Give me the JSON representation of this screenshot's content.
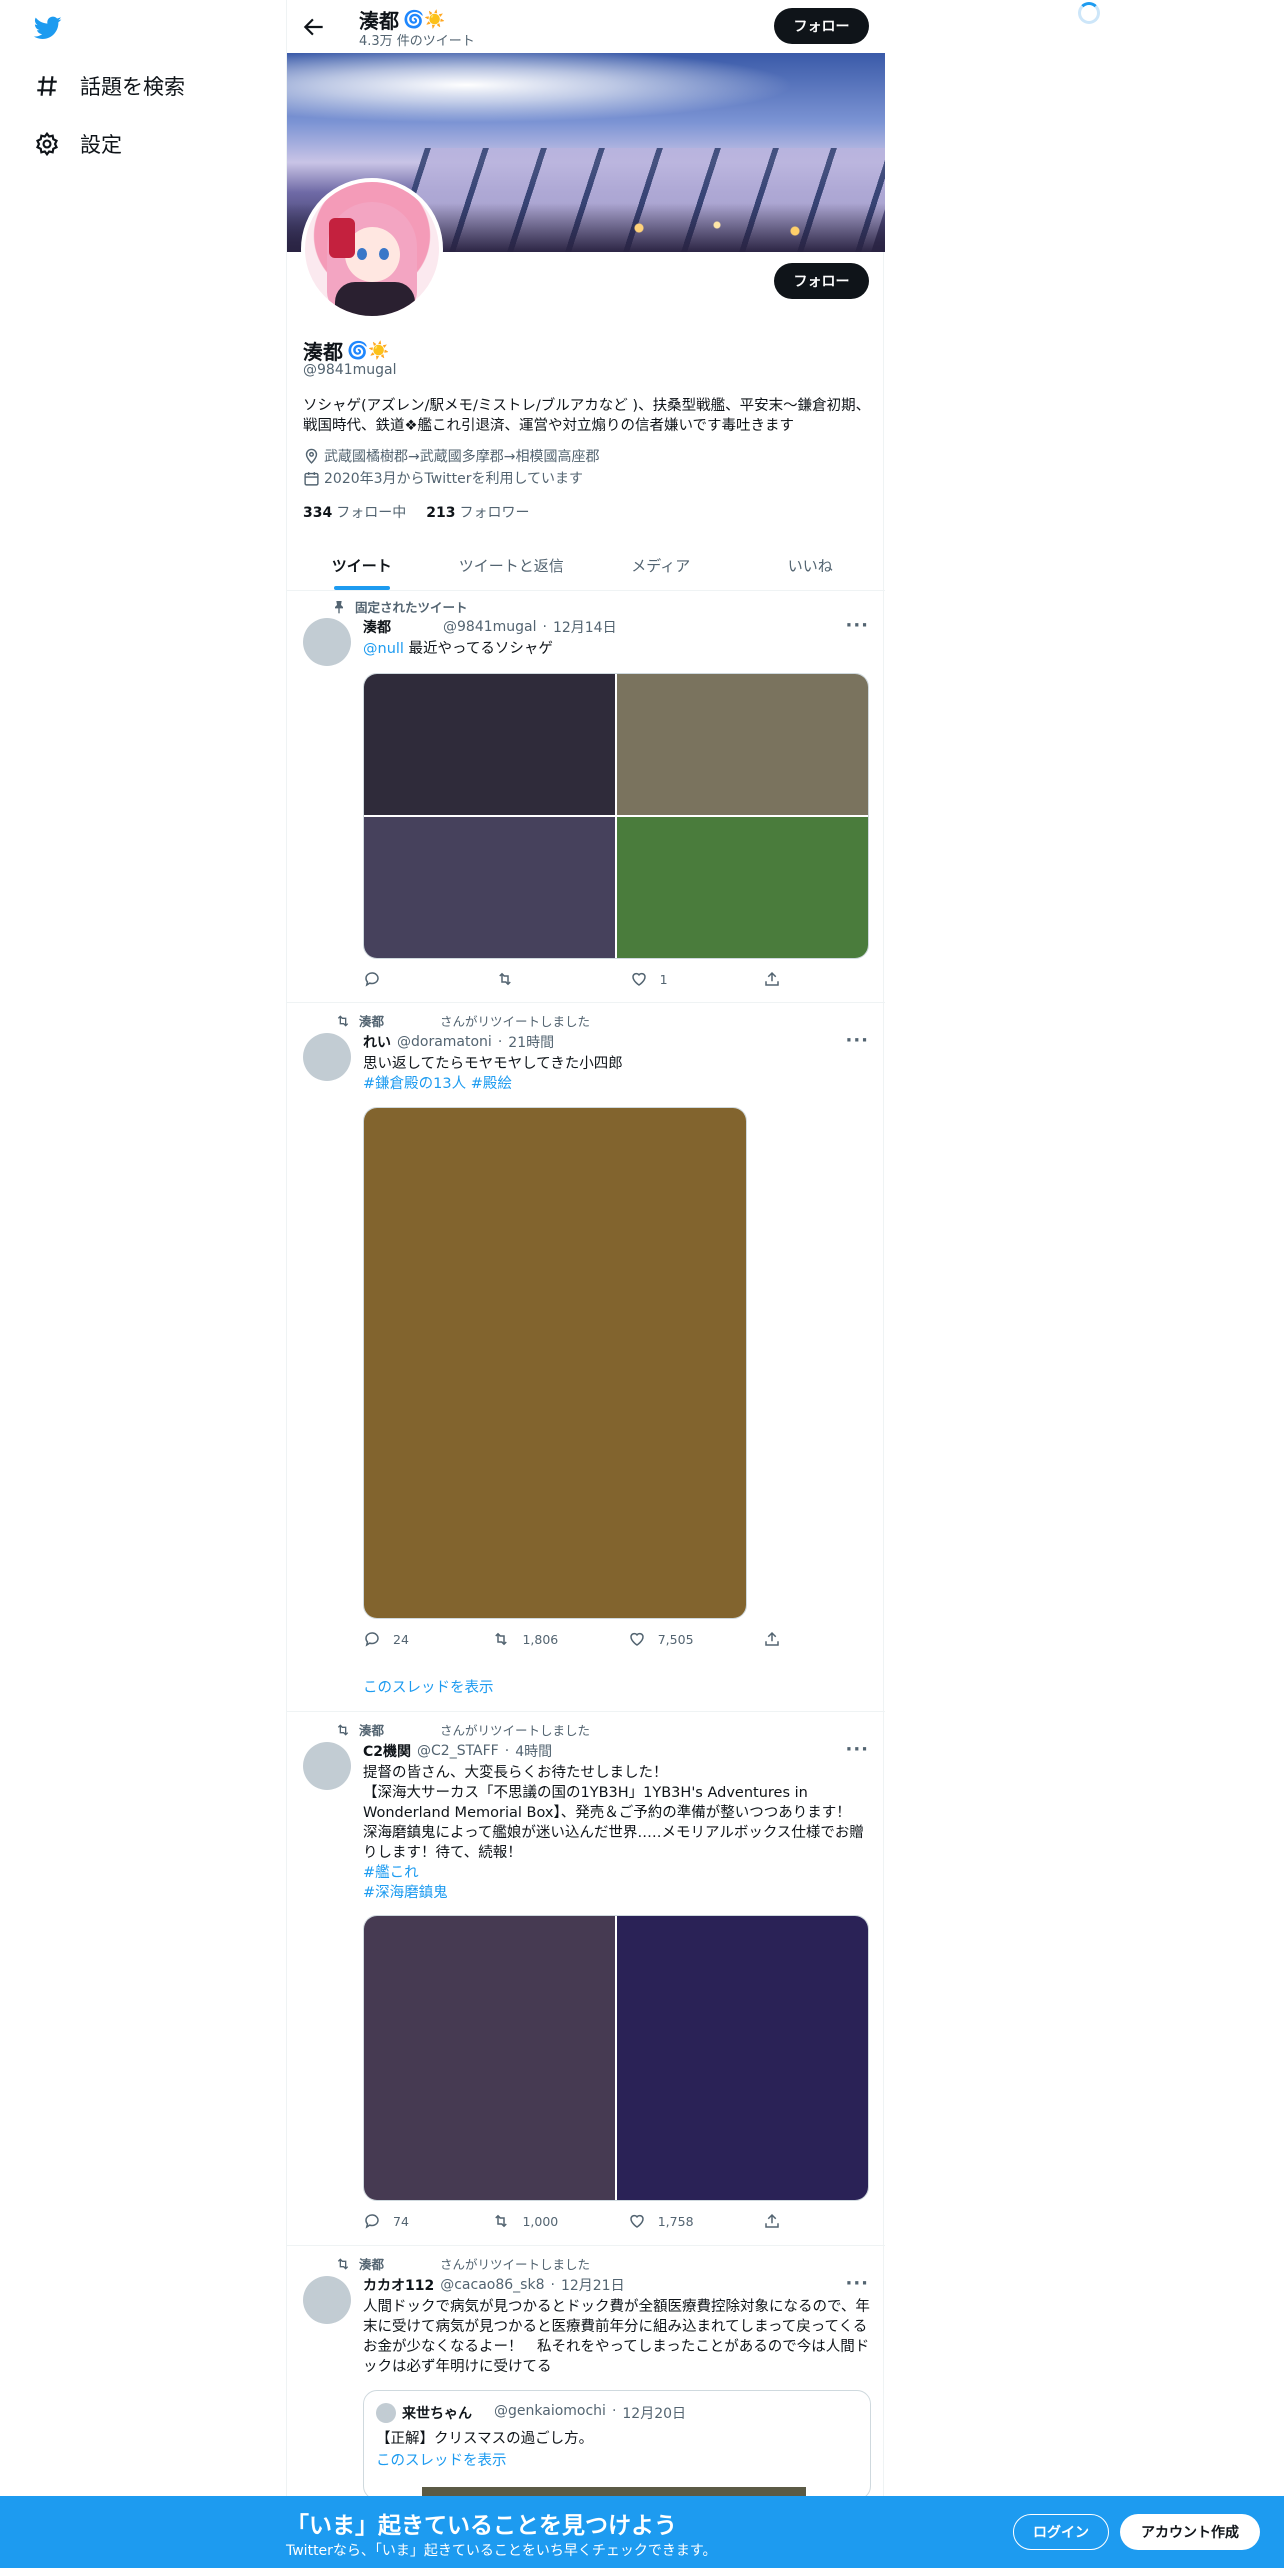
{
  "app": {
    "name": "Twitter"
  },
  "colors": {
    "accent": "#1d9bf0",
    "text": "#0f1419",
    "muted": "#536471"
  },
  "sidebar": {
    "items": [
      {
        "label": "話題を検索",
        "icon": "hashtag-icon"
      },
      {
        "label": "設定",
        "icon": "gear-icon"
      }
    ]
  },
  "header": {
    "name": "湊都",
    "tweet_count": "4.3万 件のツイート",
    "follow_label": "フォロー",
    "emoji": "🌀☀️"
  },
  "profile": {
    "name": "湊都",
    "handle": "@9841mugal",
    "bio": "ソシャゲ(アズレン/駅メモ/ミストレ/ブルアカなど )、扶桑型戦艦、平安末～鎌倉初期、戦国時代、鉄道❖艦これ引退済、運営や対立煽りの信者嫌いです毒吐きます",
    "location": "武蔵國橘樹郡→武蔵國多摩郡→相模國高座郡",
    "joined": "2020年3月からTwitterを利用しています",
    "following_count": "334",
    "following_label": "フォロー中",
    "followers_count": "213",
    "followers_label": "フォロワー",
    "follow_label": "フォロー"
  },
  "tabs": [
    {
      "label": "ツイート",
      "active": true
    },
    {
      "label": "ツイートと返信",
      "active": false
    },
    {
      "label": "メディア",
      "active": false
    },
    {
      "label": "いいね",
      "active": false
    }
  ],
  "tweets": [
    {
      "context": "固定されたツイート",
      "name": "湊都",
      "handle": "@9841mugal",
      "time": "12月14日",
      "mention": "@null",
      "text": "最近やってるソシャゲ",
      "media_colors": [
        "#2f2b3a",
        "#7a735e",
        "#46415c",
        "#4a7c3c"
      ],
      "replies": "",
      "retweets": "",
      "likes": "1"
    },
    {
      "context_name": "湊都",
      "context_suffix": "さんがリツイートしました",
      "name": "れい",
      "handle": "@doramatoni",
      "time": "21時間",
      "text": "思い返してたらモヤモヤしてきた小四郎",
      "hashtags": "#鎌倉殿の13人 #殿絵",
      "media_colors": [
        "#82642e"
      ],
      "replies": "24",
      "retweets": "1,806",
      "likes": "7,505",
      "thread": "このスレッドを表示"
    },
    {
      "context_name": "湊都",
      "context_suffix": "さんがリツイートしました",
      "name": "C2機関",
      "handle": "@C2_STAFF",
      "time": "4時間",
      "text_lines": [
        "提督の皆さん、大変長らくお待たせしました！",
        "【深海大サーカス「不思議の国の1YB3H」1YB3H's Adventures in Wonderland Memorial Box】、発売＆ご予約の準備が整いつつあります！",
        "深海磨鎮鬼によって艦娘が迷い込んだ世界…‥メモリアルボックス仕様でお贈りします！待て、続報！"
      ],
      "hashtag1": "#艦これ",
      "hashtag2": "#深海磨鎮鬼",
      "media_colors": [
        "#463a52",
        "#2a2256"
      ],
      "replies": "74",
      "retweets": "1,000",
      "likes": "1,758"
    },
    {
      "context_name": "湊都",
      "context_suffix": "さんがリツイートしました",
      "name": "カカオ112",
      "handle": "@cacao86_sk8",
      "time": "12月21日",
      "text": "人間ドックで病気が見つかるとドック費が全額医療費控除対象になるので、年末に受けて病気が見つかると医療費前年分に組み込まれてしまって戻ってくるお金が少なくなるよー！　私それをやってしまったことがあるので今は人間ドックは必ず年明けに受けてる",
      "quote": {
        "name": "来世ちゃん",
        "handle": "@genkaiomochi",
        "time": "12月20日",
        "text": "【正解】クリスマスの過ごし方。",
        "thread": "このスレッドを表示"
      }
    }
  ],
  "bottom_bar": {
    "title": "「いま」起きていることを見つけよう",
    "subtitle": "Twitterなら、「いま」起きていることをいち早くチェックできます。",
    "login_label": "ログイン",
    "signup_label": "アカウント作成"
  }
}
